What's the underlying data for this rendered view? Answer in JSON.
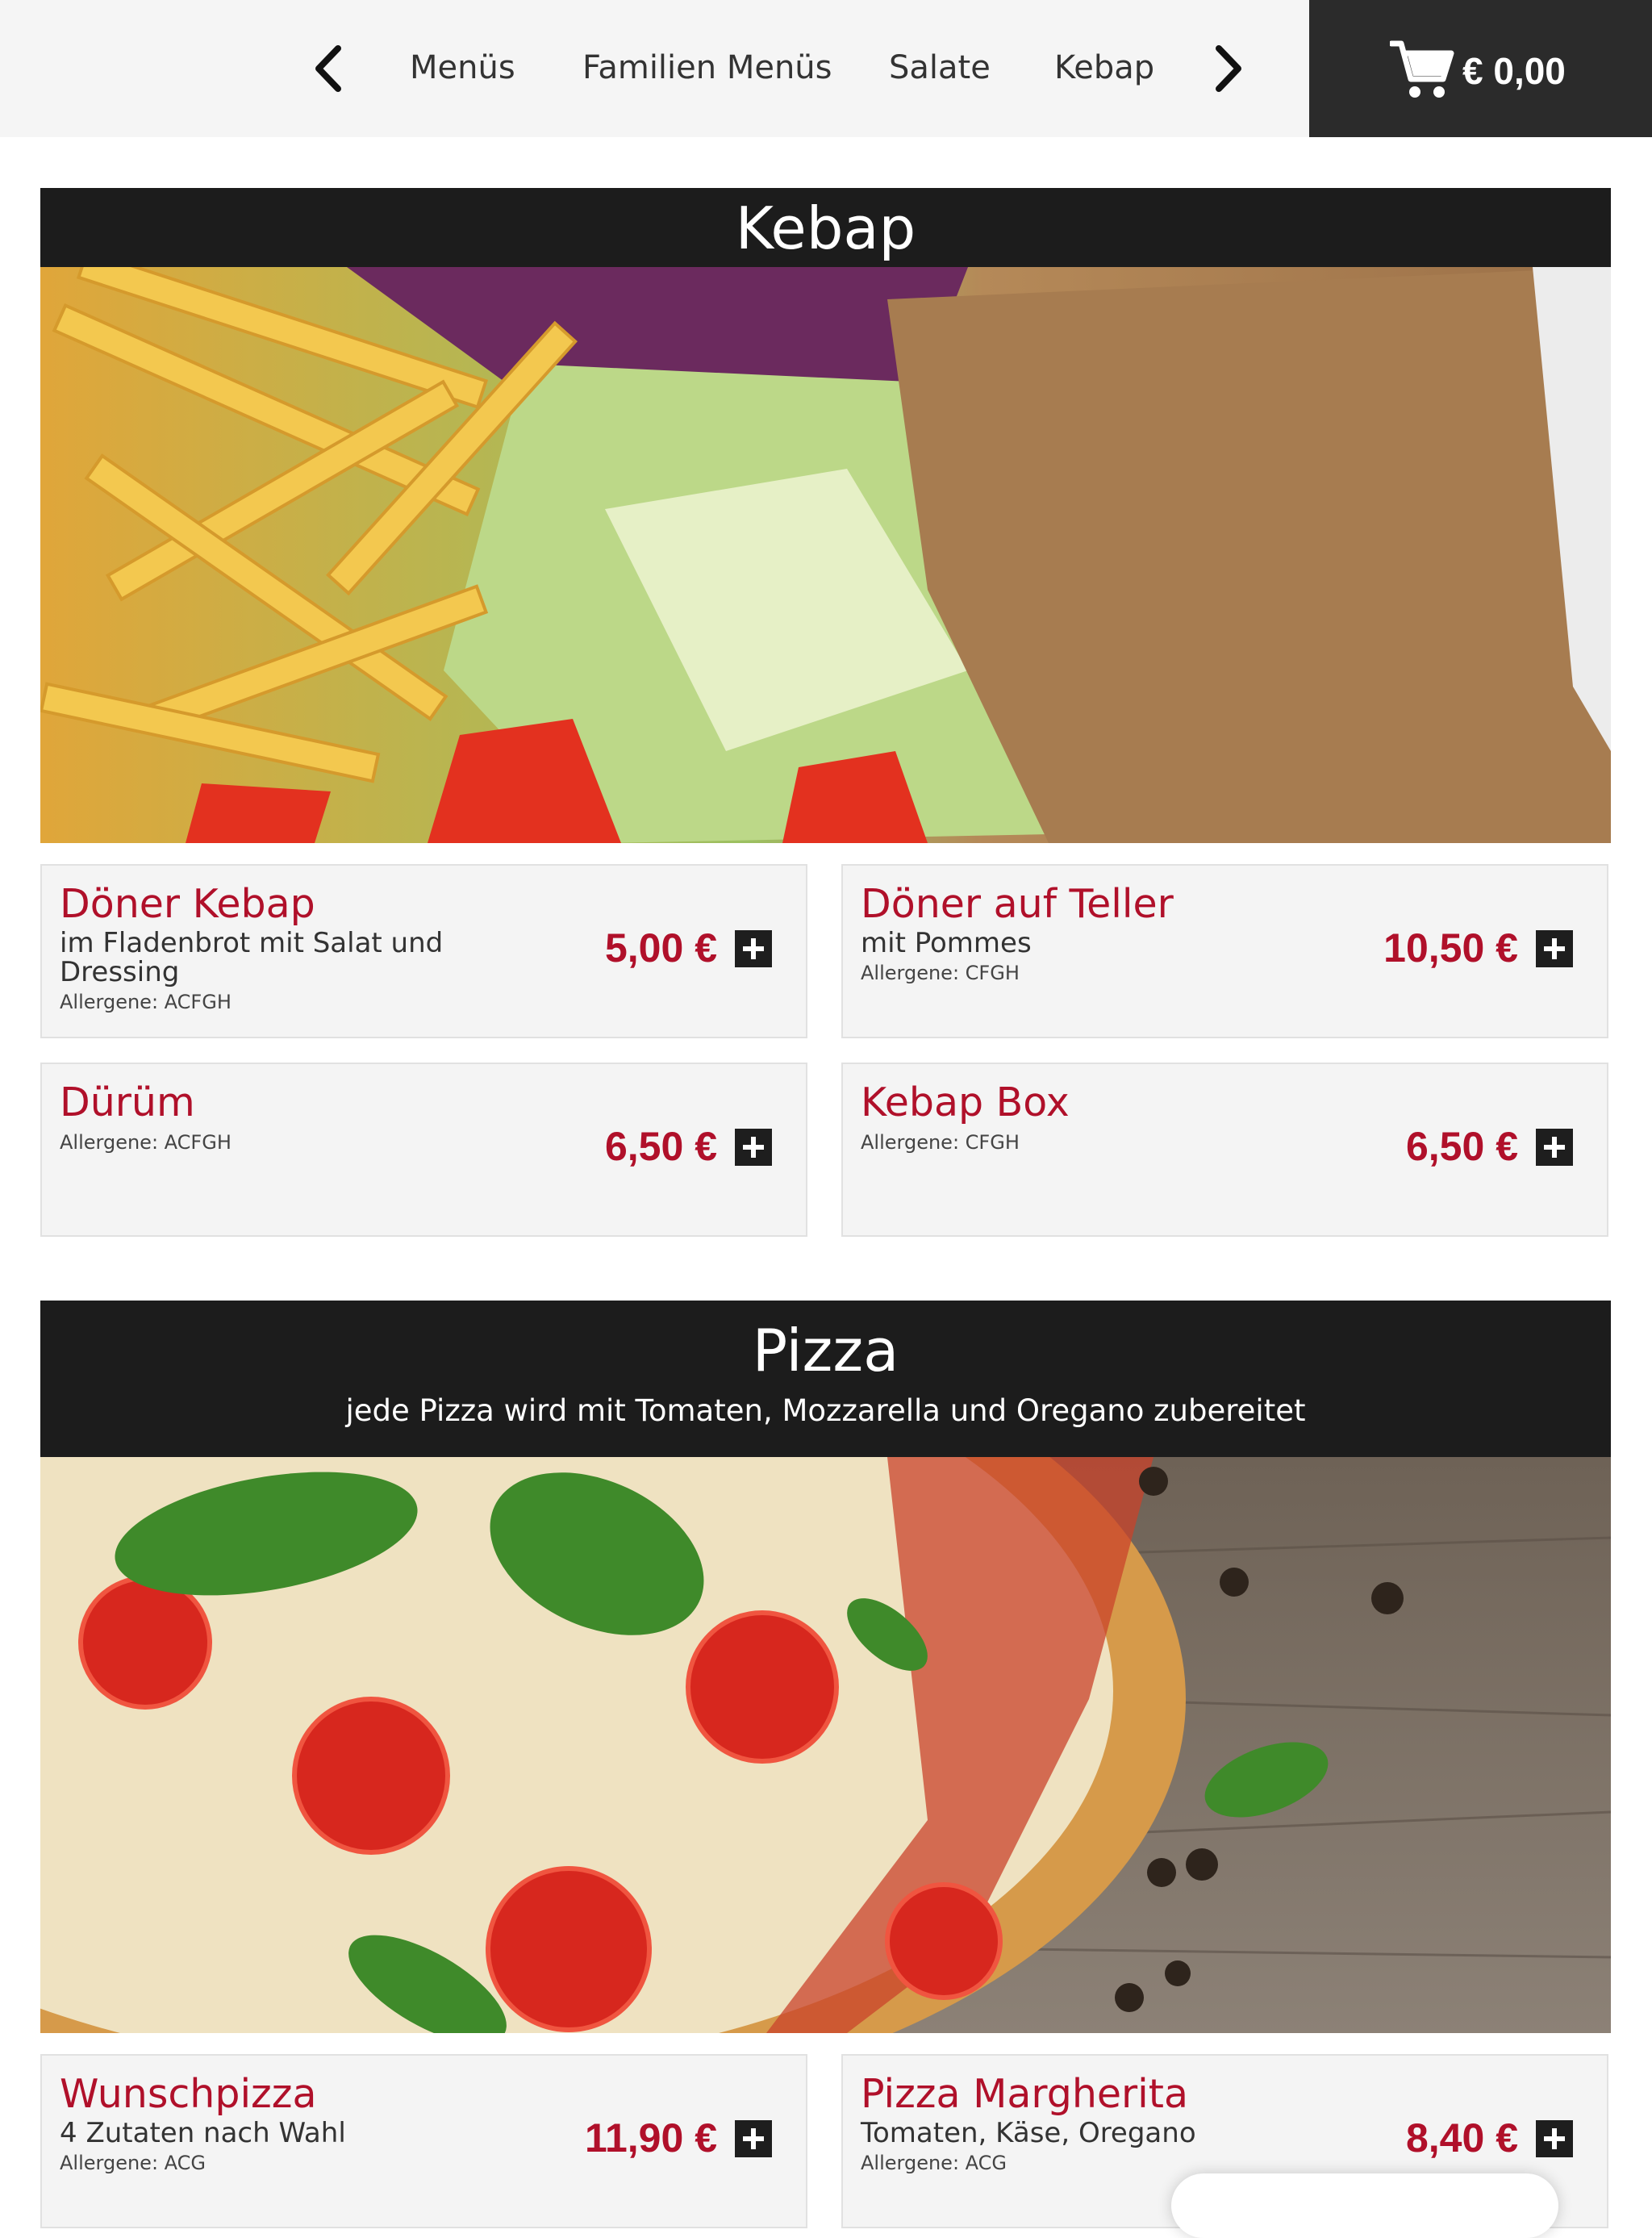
{
  "nav": {
    "prev_icon": "chevron-left-icon",
    "next_icon": "chevron-right-icon",
    "items": [
      "Menüs",
      "Familien Menüs",
      "Salate",
      "Kebap"
    ]
  },
  "cart": {
    "icon": "shopping-cart-icon",
    "total": "€ 0,00"
  },
  "sections": [
    {
      "title": "Kebap",
      "subtitle": "",
      "products": [
        {
          "name": "Döner Kebap",
          "description": "im Fladenbrot mit Salat und Dressing",
          "allergens": "Allergene: ACFGH",
          "price": "5,00 €"
        },
        {
          "name": "Döner auf Teller",
          "description": "mit Pommes",
          "allergens": "Allergene: CFGH",
          "price": "10,50 €"
        },
        {
          "name": "Dürüm",
          "description": "",
          "allergens": "Allergene: ACFGH",
          "price": "6,50 €"
        },
        {
          "name": "Kebap Box",
          "description": "",
          "allergens": "Allergene: CFGH",
          "price": "6,50 €"
        }
      ]
    },
    {
      "title": "Pizza",
      "subtitle": "jede Pizza wird mit Tomaten, Mozzarella und Oregano zubereitet",
      "products": [
        {
          "name": "Wunschpizza",
          "description": "4 Zutaten nach Wahl",
          "allergens": "Allergene: ACG",
          "price": "11,90 €"
        },
        {
          "name": "Pizza Margherita",
          "description": "Tomaten, Käse, Oregano",
          "allergens": "Allergene: ACG",
          "price": "8,40 €"
        }
      ]
    }
  ],
  "colors": {
    "accent": "#b0102a",
    "header_bg": "#1c1c1c",
    "cart_bg": "#2b2b2b",
    "card_bg": "#f4f4f4"
  }
}
